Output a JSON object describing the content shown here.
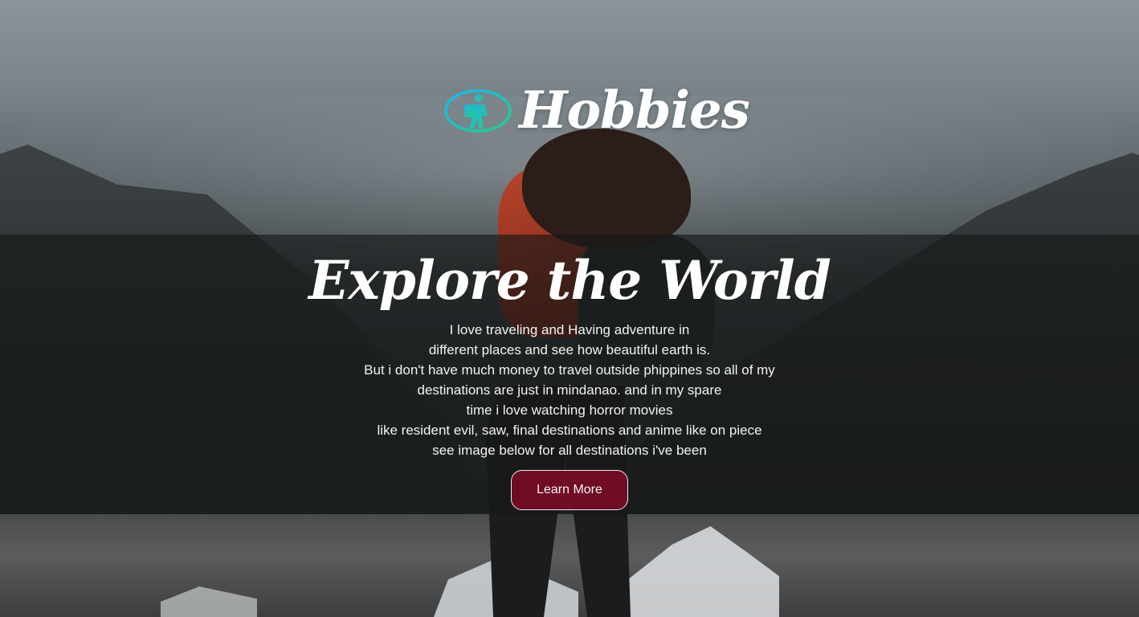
{
  "header": {
    "brand": "Hobbies",
    "logo_icon": "hiker-badge-icon",
    "logo_gradient": [
      "#1fb5e6",
      "#27c98a"
    ]
  },
  "hero": {
    "headline": "Explore the World",
    "paragraph_lines": [
      "I love traveling and Having adventure in",
      "different places and see how beautiful earth is.",
      "But i don't have much money to travel outside phippines so all of my",
      "destinations are just in mindanao. and in my spare",
      "time i love watching horror movies",
      "like resident evil, saw, final destinations and anime like on piece",
      "see image below for all destinations i've been"
    ],
    "cta_label": "Learn More",
    "cta_color": "#800a28"
  }
}
